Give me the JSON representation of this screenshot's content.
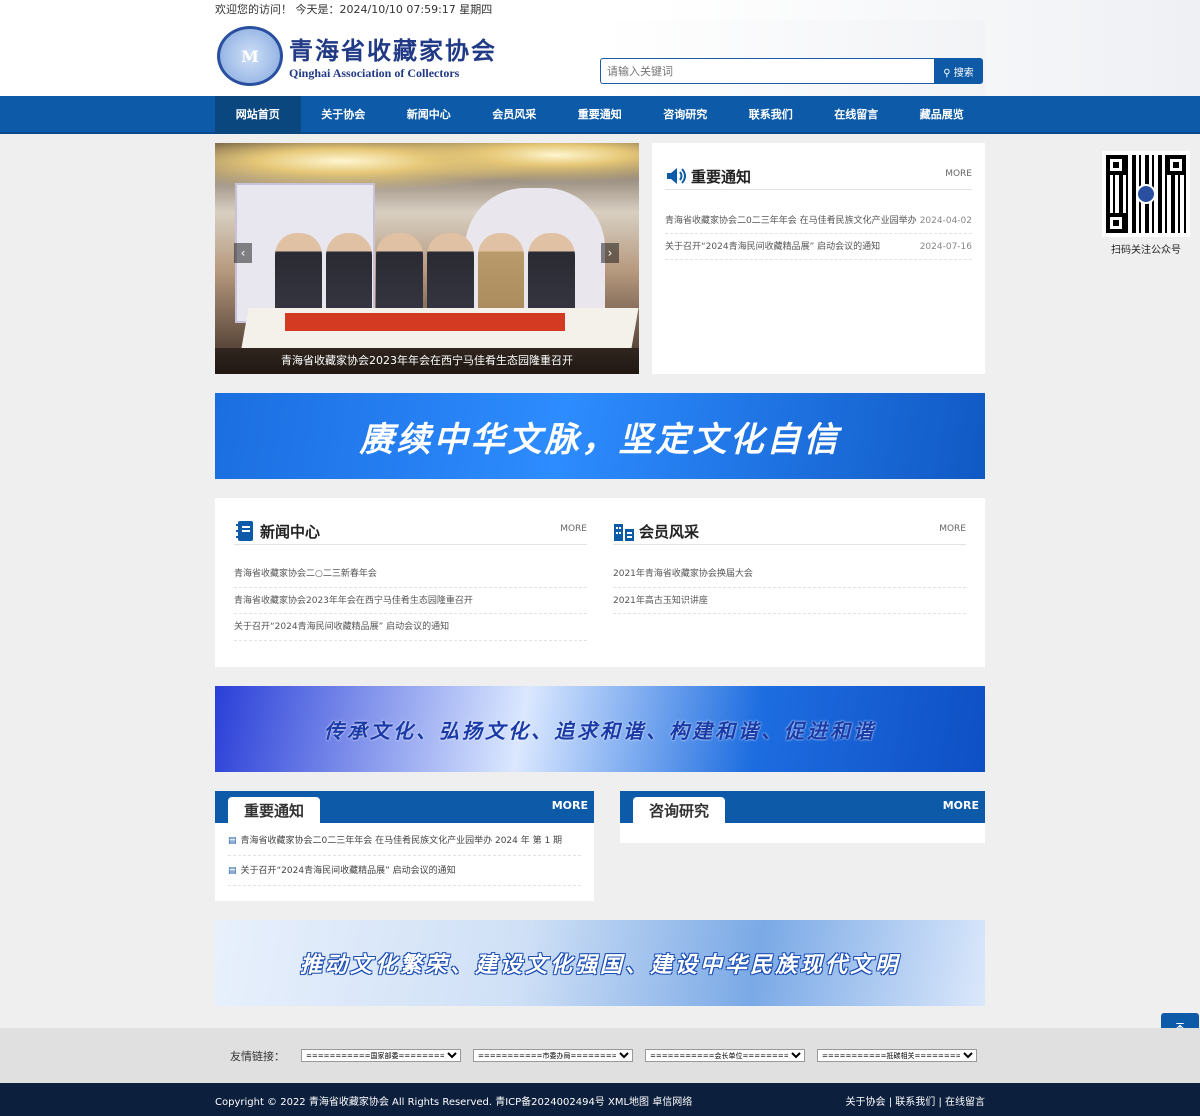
{
  "topbar": {
    "welcome": "欢迎您的访问！ 今天是：2024/10/10 07:59:17 星期四"
  },
  "logo": {
    "mark": "M",
    "cn": "青海省收藏家协会",
    "en": "Qinghai Association of Collectors"
  },
  "search": {
    "placeholder": "请输入关键词",
    "button": "搜索"
  },
  "nav": [
    "网站首页",
    "关于协会",
    "新闻中心",
    "会员风采",
    "重要通知",
    "咨询研究",
    "联系我们",
    "在线留言",
    "藏品展览"
  ],
  "slider": {
    "caption": "青海省收藏家协会2023年年会在西宁马佳肴生态园隆重召开",
    "prev": "‹",
    "next": "›"
  },
  "notice": {
    "title": "重要通知",
    "more": "MORE",
    "items": [
      {
        "text": "青海省收藏家协会二0二三年年会 在马佳肴民族文化产业园举办",
        "date": "2024-04-02"
      },
      {
        "text": "关于召开“2024青海民间收藏精品展” 启动会议的通知",
        "date": "2024-07-16"
      }
    ]
  },
  "banner1": "赓续中华文脉，坚定文化自信",
  "news": {
    "title": "新闻中心",
    "more": "MORE",
    "items": [
      "青海省收藏家协会二○二三新春年会",
      "青海省收藏家协会2023年年会在西宁马佳肴生态园隆重召开",
      "关于召开“2024青海民间收藏精品展” 启动会议的通知"
    ]
  },
  "members": {
    "title": "会员风采",
    "more": "MORE",
    "items": [
      "2021年青海省收藏家协会换届大会",
      "2021年高古玉知识讲座"
    ]
  },
  "banner2": "传承文化、弘扬文化、追求和谐、构建和谐、促进和谐",
  "notice2": {
    "title": "重要通知",
    "more": "MORE",
    "items": [
      "青海省收藏家协会二0二三年年会 在马佳肴民族文化产业园举办 2024 年 第 1 期",
      "关于召开“2024青海民间收藏精品展” 启动会议的通知"
    ]
  },
  "research": {
    "title": "咨询研究",
    "more": "MORE"
  },
  "banner3": "推动文化繁荣、建设文化强国、建设中华民族现代文明",
  "qrcode": {
    "label": "扫码关注公众号"
  },
  "friendlinks": {
    "label": "友情链接：",
    "selects": [
      "===========国家部委===========",
      "===========市委办局===========",
      "===========会长单位===========",
      "===========抵碳相关==========="
    ]
  },
  "footer": {
    "copyright": "Copyright © 2022 青海省收藏家协会 All Rights Reserved.  青ICP备2024002494号  XML地图  卓信网络",
    "links": "关于协会 | 联系我们 | 在线留言"
  },
  "colors": {
    "primary": "#0d5ba8",
    "footer": "#0c1f3d"
  }
}
